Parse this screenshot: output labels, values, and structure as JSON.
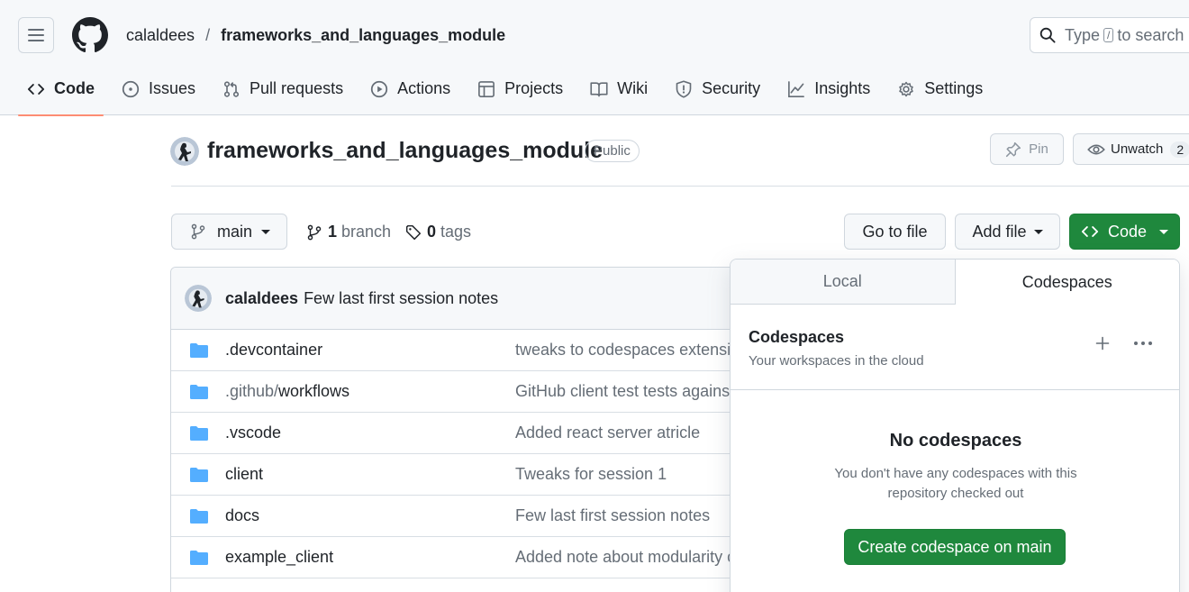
{
  "header": {
    "owner": "calaldees",
    "separator": "/",
    "repo": "frameworks_and_languages_module",
    "search": {
      "prefix": "Type",
      "key": "/",
      "suffix": "to search"
    }
  },
  "nav": {
    "tabs": [
      {
        "label": "Code",
        "icon": "code-icon",
        "active": true
      },
      {
        "label": "Issues",
        "icon": "issue-opened-icon"
      },
      {
        "label": "Pull requests",
        "icon": "git-pull-request-icon"
      },
      {
        "label": "Actions",
        "icon": "play-icon"
      },
      {
        "label": "Projects",
        "icon": "table-icon"
      },
      {
        "label": "Wiki",
        "icon": "book-icon"
      },
      {
        "label": "Security",
        "icon": "shield-icon"
      },
      {
        "label": "Insights",
        "icon": "graph-icon"
      },
      {
        "label": "Settings",
        "icon": "gear-icon"
      }
    ]
  },
  "repo": {
    "title": "frameworks_and_languages_module",
    "visibility": "Public",
    "pin_label": "Pin",
    "unwatch_label": "Unwatch",
    "watch_count": "2"
  },
  "toolbar": {
    "branch": "main",
    "branch_count": "1",
    "branch_word": "branch",
    "tag_count": "0",
    "tag_word": "tags",
    "goto_label": "Go to file",
    "addfile_label": "Add file",
    "code_label": "Code"
  },
  "commit": {
    "author": "calaldees",
    "message": "Few last first session notes"
  },
  "files": [
    {
      "name": ".devcontainer",
      "message": "tweaks to codespaces extensio"
    },
    {
      "name_dim": ".github/",
      "name": "workflows",
      "message": "GitHub client test tests against"
    },
    {
      "name": ".vscode",
      "message": "Added react server atricle"
    },
    {
      "name": "client",
      "message": "Tweaks for session 1"
    },
    {
      "name": "docs",
      "message": "Few last first session notes"
    },
    {
      "name": "example_client",
      "message": "Added note about modularity c"
    }
  ],
  "panel": {
    "tab_local": "Local",
    "tab_codespaces": "Codespaces",
    "title": "Codespaces",
    "subtitle": "Your workspaces in the cloud",
    "empty_title": "No codespaces",
    "empty_text": "You don't have any codespaces with this repository checked out",
    "create_label": "Create codespace on main"
  },
  "colors": {
    "primary_green": "#1f883d",
    "active_tab_underline": "#fd8c73",
    "folder_blue": "#54aeff",
    "muted_text": "#656d76"
  }
}
